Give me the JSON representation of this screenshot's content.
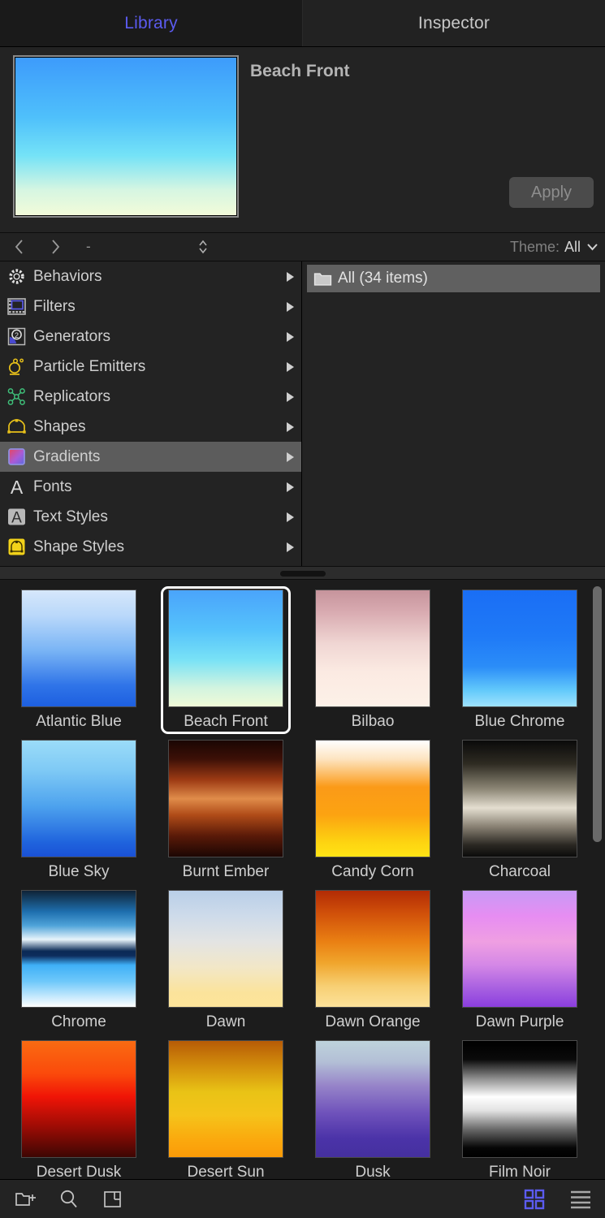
{
  "tabs": [
    {
      "label": "Library",
      "active": true
    },
    {
      "label": "Inspector",
      "active": false
    }
  ],
  "preview": {
    "title": "Beach Front",
    "apply_label": "Apply",
    "swatch_gradient": "linear-gradient(to bottom, #3d9bfb 0%, #4fc0fb 38%, #74e2f7 62%, #d6f6e2 84%, #f2fbd9 100%)"
  },
  "navstrip": {
    "back_icon": "chevron-left-icon",
    "forward_icon": "chevron-right-icon",
    "path_label": "-",
    "stepper_icon": "stepper-updown-icon",
    "theme_label": "Theme:",
    "theme_value": "All",
    "theme_options": [
      "All"
    ]
  },
  "categories": [
    {
      "label": "Behaviors",
      "icon": "gear-icon",
      "selected": false
    },
    {
      "label": "Filters",
      "icon": "filmstrip-icon",
      "selected": false
    },
    {
      "label": "Generators",
      "icon": "generator-icon",
      "selected": false
    },
    {
      "label": "Particle Emitters",
      "icon": "particle-emitter-icon",
      "selected": false
    },
    {
      "label": "Replicators",
      "icon": "replicator-icon",
      "selected": false
    },
    {
      "label": "Shapes",
      "icon": "shape-icon",
      "selected": false
    },
    {
      "label": "Gradients",
      "icon": "gradient-icon",
      "selected": true
    },
    {
      "label": "Fonts",
      "icon": "font-a-icon",
      "selected": false
    },
    {
      "label": "Text Styles",
      "icon": "text-style-icon",
      "selected": false
    },
    {
      "label": "Shape Styles",
      "icon": "shape-style-icon",
      "selected": false
    }
  ],
  "folders": [
    {
      "label": "All (34 items)",
      "icon": "folder-icon",
      "selected": true
    }
  ],
  "gradients": [
    {
      "name": "Atlantic Blue",
      "selected": false,
      "css": "linear-gradient(to bottom, #d6e7fb 0%, #b9d8fa 22%, #79b4f5 52%, #2f74e8 82%, #1d5fe0 100%)"
    },
    {
      "name": "Beach Front",
      "selected": true,
      "css": "linear-gradient(to bottom, #4aa4fb 0%, #55c2fb 34%, #79e2f6 60%, #d2f4e0 84%, #f0fad7 100%)"
    },
    {
      "name": "Bilbao",
      "selected": false,
      "css": "linear-gradient(to bottom, #c6949c 0%, #d8aab0 18%, #f0d6d3 46%, #fbeae2 70%, #fdf1e8 100%)"
    },
    {
      "name": "Blue Chrome",
      "selected": false,
      "css": "linear-gradient(to bottom, #1a6ef5 0%, #1f7af7 40%, #2b8df8 66%, #62c9fb 86%, #9fe2fd 100%)"
    },
    {
      "name": "Blue Sky",
      "selected": false,
      "css": "linear-gradient(to bottom, #9bdcf8 0%, #7ec9f5 26%, #4ea3ee 56%, #1f63dd 88%, #1a51d6 100%)"
    },
    {
      "name": "Burnt Ember",
      "selected": false,
      "css": "linear-gradient(to bottom, #1a0603 0%, #3d1007 16%, #9e3b14 34%, #e08c4a 50%, #b04c18 64%, #5a1a08 82%, #1c0603 100%)"
    },
    {
      "name": "Candy Corn",
      "selected": false,
      "css": "linear-gradient(to bottom, #ffffff 0%, #fde4c0 16%, #fb9a18 40%, #fca311 64%, #fdd411 88%, #ffe415 100%)"
    },
    {
      "name": "Charcoal",
      "selected": false,
      "css": "linear-gradient(to bottom, #0a0a0a 0%, #2e2b22 20%, #8e8877 42%, #e4ded0 58%, #8a8274 74%, #2a2722 90%, #0b0b0b 100%)"
    },
    {
      "name": "Chrome",
      "selected": false,
      "css": "linear-gradient(to bottom, #0f2336 0%, #1e6fae 18%, #4fa3d9 30%, #e8f4fb 42%, #0a2a55 52%, #0d2c5c 56%, #3fb0f7 64%, #6ec8fa 78%, #ffffff 100%)"
    },
    {
      "name": "Dawn",
      "selected": false,
      "css": "linear-gradient(to bottom, #b9cfe8 0%, #cedbea 22%, #e3e4e3 44%, #f2e7c7 66%, #fbe39b 88%, #fde49a 100%)"
    },
    {
      "name": "Dawn Orange",
      "selected": false,
      "css": "linear-gradient(to bottom, #b22b05 0%, #d1510a 20%, #ea8013 44%, #f0a52c 62%, #f7cf73 82%, #fce29a 100%)"
    },
    {
      "name": "Dawn Purple",
      "selected": false,
      "css": "linear-gradient(to bottom, #c79af5 0%, #e78df2 22%, #ef9fe2 44%, #d487e6 64%, #a45ce0 86%, #8b3ede 100%)"
    },
    {
      "name": "Desert Dusk",
      "selected": false,
      "css": "linear-gradient(to bottom, #f96b12 0%, #fb4a0b 28%, #f01406 48%, #9c0c05 74%, #3d0603 100%)"
    },
    {
      "name": "Desert Sun",
      "selected": false,
      "css": "linear-gradient(to bottom, #b75b06 0%, #d38f0c 22%, #e9c316 44%, #f5c31a 64%, #fba80d 86%, #fb9b08 100%)"
    },
    {
      "name": "Dusk",
      "selected": false,
      "css": "linear-gradient(to bottom, #bed3dc 0%, #b3bfd6 18%, #9785c9 38%, #6f52bb 62%, #4b33a8 84%, #45309f 100%)"
    },
    {
      "name": "Film Noir",
      "selected": false,
      "css": "linear-gradient(to bottom, #000000 0%, #0a0a0a 16%, #8c8c8c 32%, #ffffff 48%, #e2e2e2 60%, #6a6a6a 76%, #060606 92%, #000000 100%)"
    }
  ],
  "bottombar": {
    "new_folder_icon": "new-folder-icon",
    "search_icon": "search-icon",
    "panel_icon": "panel-layout-icon",
    "grid_view_icon": "grid-view-icon",
    "list_view_icon": "list-view-icon"
  },
  "colors": {
    "accent": "#5b5bef",
    "selection": "#5c5c5c",
    "background": "#1c1c1c",
    "panel": "#232323"
  }
}
